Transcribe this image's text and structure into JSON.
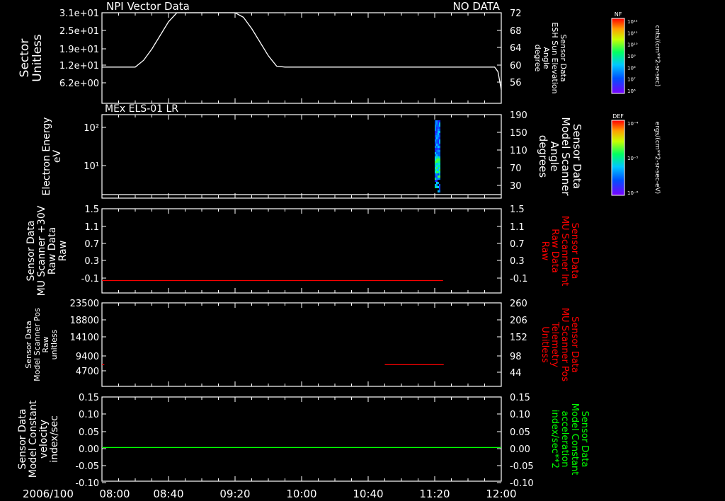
{
  "date_label": "2006/100",
  "x_ticks": [
    "08:00",
    "08:40",
    "09:20",
    "10:00",
    "10:40",
    "11:20",
    "12:00"
  ],
  "colors": {
    "background": "#000000",
    "axes": "#ffffff",
    "red": "#ff0000",
    "green": "#00ff00"
  },
  "chart_data": [
    {
      "type": "line",
      "title": "NPI Vector Data",
      "status": "NO DATA",
      "ylabel": [
        "Sector",
        "Unitless"
      ],
      "yticks": [
        "3.1e+01",
        "2.5e+01",
        "1.9e+01",
        "1.2e+01",
        "6.2e+00"
      ],
      "ylabel_right": [
        "Sensor Data",
        "ESH Sun Elevation",
        "Angle",
        "degree"
      ],
      "yticks_right": [
        "72",
        "68",
        "64",
        "60",
        "56"
      ],
      "ylim_right": [
        52,
        72
      ],
      "series": [
        {
          "x": [
            "08:00",
            "08:15",
            "08:20",
            "08:25",
            "08:30",
            "08:35",
            "08:40",
            "08:45",
            "08:50",
            "08:55",
            "09:00",
            "09:05",
            "09:10",
            "09:15",
            "09:20",
            "09:25",
            "09:30",
            "09:35",
            "09:40",
            "09:45",
            "09:50",
            "11:56",
            "11:58",
            "12:00"
          ],
          "values": [
            60,
            60,
            60,
            61.5,
            64,
            67,
            70,
            72,
            72,
            72,
            72,
            72,
            72,
            72,
            72,
            71,
            68.5,
            65.5,
            62.5,
            60.2,
            60,
            60,
            59,
            55
          ]
        }
      ]
    },
    {
      "type": "heatmap",
      "title": "MEx ELS-01 LR",
      "ylabel": [
        "Electron Energy",
        "eV"
      ],
      "yticks": [
        "10²",
        "10¹"
      ],
      "ylabel_right": [
        "Sensor Data",
        "Model Scanner",
        "Angle",
        "degrees"
      ],
      "yticks_right": [
        "190",
        "150",
        "110",
        "70",
        "30"
      ],
      "ylim_right": [
        10,
        190
      ],
      "data_interval": [
        "11:20",
        "11:23"
      ],
      "baseline_right": 10
    },
    {
      "type": "line",
      "ylabel": [
        "Sensor Data",
        "MU Scanner +30V",
        "Raw Data",
        "Raw"
      ],
      "yticks": [
        "1.5",
        "1.1",
        "0.7",
        "0.3",
        "-0.1"
      ],
      "ylabel_right": [
        "Sensor Data",
        "MU Scanner Int",
        "Raw Data",
        "Raw"
      ],
      "yticks_right": [
        "1.5",
        "1.1",
        "0.7",
        "0.3",
        "-0.1"
      ],
      "ylim": [
        -0.3,
        1.5
      ],
      "series": [
        {
          "x": [
            "08:00",
            "11:25"
          ],
          "values": [
            -0.035,
            -0.035
          ],
          "color": "#ff0000"
        }
      ]
    },
    {
      "type": "line",
      "ylabel": [
        "Sensor Data",
        "Model Scanner Pos",
        "Raw",
        "unitless"
      ],
      "yticks": [
        "23500",
        "18800",
        "14100",
        "9400",
        "4700"
      ],
      "ylabel_right": [
        "Sensor Data",
        "MU Scanner Pos",
        "Telemetry",
        "Unitless"
      ],
      "yticks_right": [
        "260",
        "206",
        "152",
        "98",
        "44"
      ],
      "ylim_right": [
        17,
        260
      ],
      "series": [
        {
          "x": [
            "08:00",
            "08:01"
          ],
          "values": [
            80,
            80
          ],
          "color": "#ff0000"
        },
        {
          "x": [
            "10:50",
            "11:25"
          ],
          "values": [
            80,
            80
          ],
          "color": "#ff0000"
        }
      ]
    },
    {
      "type": "line",
      "ylabel": [
        "Sensor Data",
        "Model Constant",
        "velocity",
        "index/sec"
      ],
      "yticks": [
        "0.15",
        "0.10",
        "0.05",
        "0.00",
        "-0.05",
        "-0.10"
      ],
      "ylabel_right": [
        "Sensor Data",
        "Model Constant",
        "acceleration",
        "index/sec**2"
      ],
      "yticks_right": [
        "0.15",
        "0.10",
        "0.05",
        "0.00",
        "-0.05",
        "-0.10"
      ],
      "ylim": [
        -0.1,
        0.15
      ],
      "series": [
        {
          "x": [
            "08:00",
            "12:00"
          ],
          "values": [
            0,
            0
          ],
          "color": "#00ff00"
        }
      ]
    }
  ],
  "colorbars": [
    {
      "label": "NF",
      "unit": "cnts/(cm**2-sr-sec)",
      "ticks": [
        "10¹²",
        "10¹¹",
        "10¹⁰",
        "10⁹",
        "10⁸",
        "10⁷",
        "10⁶"
      ]
    },
    {
      "label": "DEF",
      "unit": "ergs/(cm**2-sr-sec-eV)",
      "ticks": [
        "10⁻⁴",
        "10⁻⁵",
        "10⁻⁶"
      ]
    }
  ]
}
